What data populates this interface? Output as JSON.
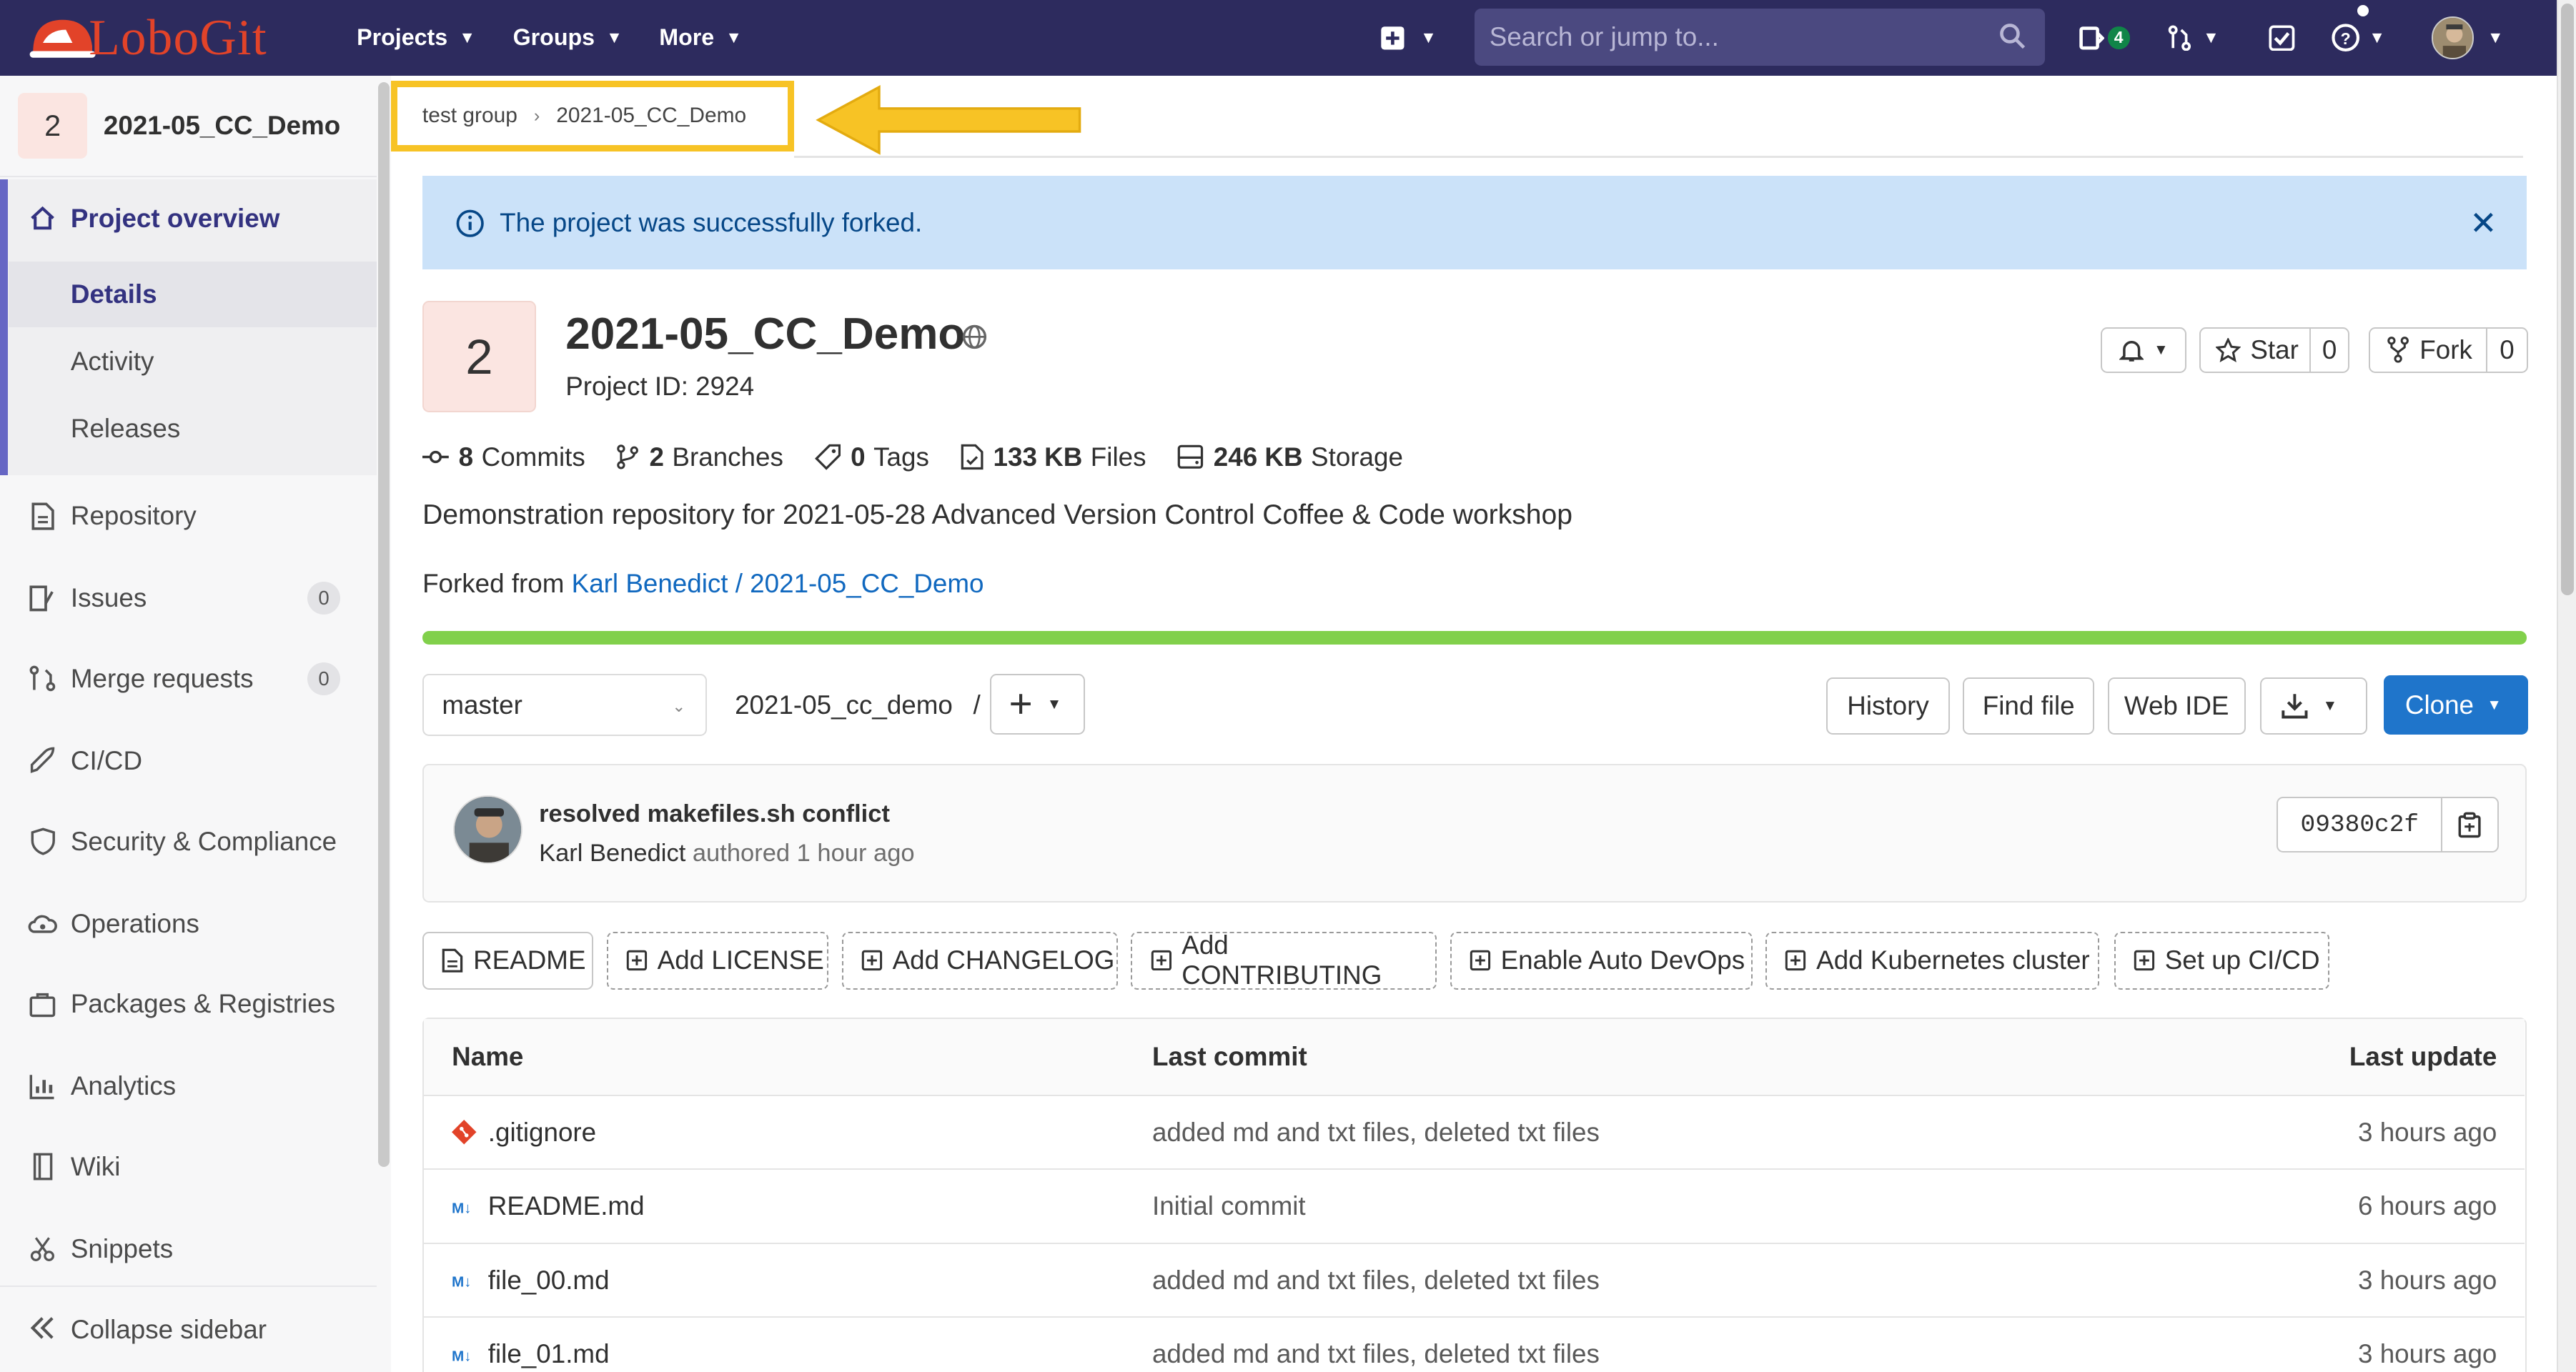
{
  "topbar": {
    "logo_text": "LoboGit",
    "nav": [
      {
        "label": "Projects"
      },
      {
        "label": "Groups"
      },
      {
        "label": "More"
      }
    ],
    "search_placeholder": "Search or jump to...",
    "issues_badge": "4"
  },
  "sidebar": {
    "project_avatar": "2",
    "project_name": "2021-05_CC_Demo",
    "overview_label": "Project overview",
    "sub_items": [
      "Details",
      "Activity",
      "Releases"
    ],
    "items": [
      {
        "label": "Repository",
        "icon": "document-icon"
      },
      {
        "label": "Issues",
        "icon": "issues-icon",
        "count": "0"
      },
      {
        "label": "Merge requests",
        "icon": "merge-request-icon",
        "count": "0"
      },
      {
        "label": "CI/CD",
        "icon": "rocket-icon"
      },
      {
        "label": "Security & Compliance",
        "icon": "shield-icon"
      },
      {
        "label": "Operations",
        "icon": "cloud-gear-icon"
      },
      {
        "label": "Packages & Registries",
        "icon": "package-icon"
      },
      {
        "label": "Analytics",
        "icon": "chart-icon"
      },
      {
        "label": "Wiki",
        "icon": "book-icon"
      },
      {
        "label": "Snippets",
        "icon": "scissors-icon"
      }
    ],
    "collapse_label": "Collapse sidebar"
  },
  "breadcrumb": {
    "items": [
      "test group",
      "2021-05_CC_Demo"
    ],
    "highlight_color": "#f7c325"
  },
  "alert": {
    "message": "The project was successfully forked.",
    "color": "#cbe2f9"
  },
  "project": {
    "avatar": "2",
    "title": "2021-05_CC_Demo",
    "id_label": "Project ID: 2924",
    "star_label": "Star",
    "star_count": "0",
    "fork_label": "Fork",
    "fork_count": "0",
    "stats": [
      {
        "value": "8",
        "label": "Commits",
        "icon": "commit-icon"
      },
      {
        "value": "2",
        "label": "Branches",
        "icon": "branch-icon"
      },
      {
        "value": "0",
        "label": "Tags",
        "icon": "tag-icon"
      },
      {
        "value": "133 KB",
        "label": "Files",
        "icon": "file-icon"
      },
      {
        "value": "246 KB",
        "label": "Storage",
        "icon": "storage-icon"
      }
    ],
    "description": "Demonstration repository for 2021-05-28 Advanced Version Control Coffee & Code workshop",
    "forked_prefix": "Forked from ",
    "forked_link": "Karl Benedict / 2021-05_CC_Demo",
    "language_bar_fraction": 1.0,
    "language_bar_color": "#81d04b"
  },
  "repo_toolbar": {
    "branch": "master",
    "path": "2021-05_cc_demo",
    "path_sep": "/",
    "history": "History",
    "find_file": "Find file",
    "web_ide": "Web IDE",
    "clone": "Clone"
  },
  "last_commit": {
    "title": "resolved makefiles.sh conflict",
    "author": "Karl Benedict",
    "authored": " authored 1 hour ago",
    "sha": "09380c2f"
  },
  "quick_actions": [
    "README",
    "Add LICENSE",
    "Add CHANGELOG",
    "Add CONTRIBUTING",
    "Enable Auto DevOps",
    "Add Kubernetes cluster",
    "Set up CI/CD"
  ],
  "file_table": {
    "headers": [
      "Name",
      "Last commit",
      "Last update"
    ],
    "rows": [
      {
        "name": ".gitignore",
        "icon": "git-icon",
        "commit": "added md and txt files, deleted txt files",
        "updated": "3 hours ago"
      },
      {
        "name": "README.md",
        "icon": "markdown-icon",
        "commit": "Initial commit",
        "updated": "6 hours ago"
      },
      {
        "name": "file_00.md",
        "icon": "markdown-icon",
        "commit": "added md and txt files, deleted txt files",
        "updated": "3 hours ago"
      },
      {
        "name": "file_01.md",
        "icon": "markdown-icon",
        "commit": "added md and txt files, deleted txt files",
        "updated": "3 hours ago"
      }
    ]
  }
}
